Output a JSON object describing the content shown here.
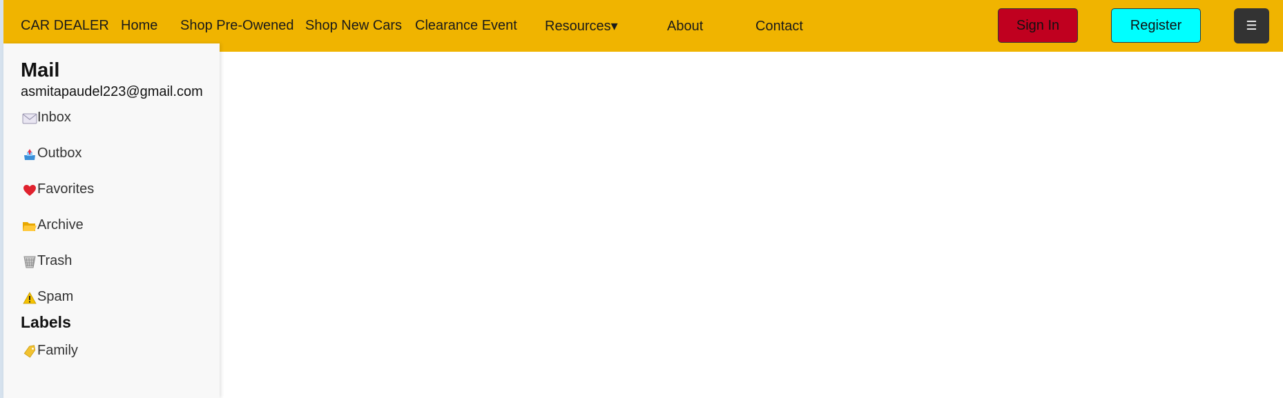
{
  "navbar": {
    "brand": "CAR DEALER",
    "links": [
      "Home",
      "Shop Pre-Owened",
      "Shop New Cars",
      "Clearance Event",
      "Resources▾",
      "About",
      "Contact"
    ],
    "sign_in": "Sign In",
    "register": "Register",
    "menu_glyph": "☰",
    "colors": {
      "bar": "#f0b400",
      "sign_in": "#c0001f",
      "register": "#00ffff",
      "menu": "#333333"
    }
  },
  "sidebar": {
    "title": "Mail",
    "email": "asmitapaudel223@gmail.com",
    "items": [
      {
        "label": "Inbox",
        "icon": "envelope-icon"
      },
      {
        "label": "Outbox",
        "icon": "outbox-tray-icon"
      },
      {
        "label": "Favorites",
        "icon": "heart-icon"
      },
      {
        "label": "Archive",
        "icon": "folder-icon"
      },
      {
        "label": "Trash",
        "icon": "wastebasket-icon"
      },
      {
        "label": "Spam",
        "icon": "warning-icon"
      }
    ],
    "labels_title": "Labels",
    "labels": [
      {
        "label": "Family",
        "icon": "tag-icon"
      }
    ]
  }
}
